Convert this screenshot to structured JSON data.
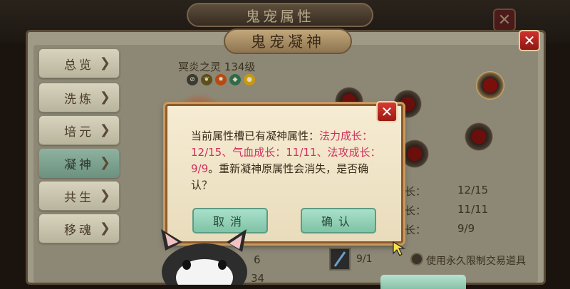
{
  "back_window": {
    "title": "鬼宠属性",
    "close_label": "✕"
  },
  "window": {
    "title": "鬼宠凝神",
    "close_label": "✕"
  },
  "sidebar": {
    "items": [
      {
        "label": "总览"
      },
      {
        "label": "洗炼"
      },
      {
        "label": "培元"
      },
      {
        "label": "凝神",
        "active": true
      },
      {
        "label": "共生"
      },
      {
        "label": "移魂"
      }
    ],
    "chevron": "❯"
  },
  "pet": {
    "name": "冥炎之灵 134级",
    "badges": [
      "mute-icon",
      "leaf-icon",
      "fire-icon",
      "drop-icon",
      "coin-icon"
    ]
  },
  "attributes": {
    "rows": [
      {
        "label": "长：",
        "value": "12/15"
      },
      {
        "label": "长：",
        "value": "11/11"
      },
      {
        "label": "长：",
        "value": "9/9"
      }
    ]
  },
  "left_values": [
    "6",
    "34"
  ],
  "item": {
    "count": "9/1",
    "icon": "sword-icon"
  },
  "option": {
    "label": "使用永久限制交易道具"
  },
  "dialog": {
    "text_prefix": "当前属性槽已有凝神属性：",
    "text_highlight": "法力成长：12/15、气血成长：11/11、法攻成长：9/9",
    "text_suffix": "。重新凝神原属性会消失，是否确认？",
    "close_label": "✕",
    "cancel_label": "取消",
    "confirm_label": "确认"
  },
  "colors": {
    "highlight": "#d0305c",
    "button_green": "#8fcfb4",
    "close_red": "#c82a24"
  }
}
